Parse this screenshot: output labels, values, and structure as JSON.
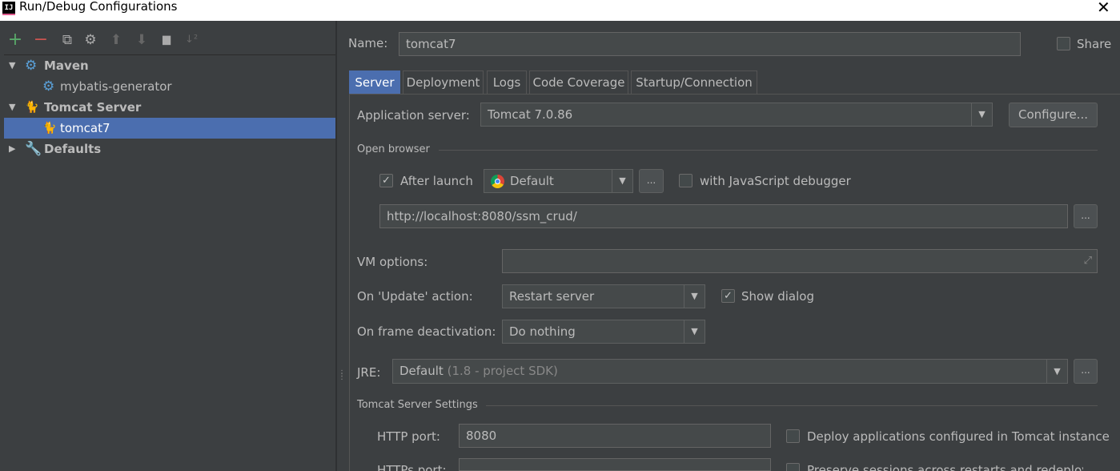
{
  "window": {
    "title": "Run/Debug Configurations",
    "app_icon": "IJ"
  },
  "toolbar": {
    "add": "+",
    "remove": "−",
    "copy": "⧉",
    "edit": "⚙",
    "up": "⬆",
    "down": "⬇",
    "folder": "▆",
    "sort": "↓²"
  },
  "tree": {
    "items": [
      {
        "label": "Maven",
        "icon": "maven-gear-icon",
        "expanded": true
      },
      {
        "label": "mybatis-generator",
        "icon": "maven-gear-icon"
      },
      {
        "label": "Tomcat Server",
        "icon": "tomcat-icon",
        "expanded": true
      },
      {
        "label": "tomcat7",
        "icon": "tomcat-icon",
        "selected": true
      },
      {
        "label": "Defaults",
        "icon": "wrench-icon",
        "expanded": false
      }
    ]
  },
  "form": {
    "name_label": "Name:",
    "name_value": "tomcat7",
    "share_label": "Share",
    "tabs": [
      "Server",
      "Deployment",
      "Logs",
      "Code Coverage",
      "Startup/Connection"
    ],
    "app_server_label": "Application server:",
    "app_server_value": "Tomcat 7.0.86",
    "configure_label": "Configure...",
    "open_browser_label": "Open browser",
    "after_launch_label": "After launch",
    "browser_value": "Default",
    "ellipsis": "...",
    "js_debugger_label": "with JavaScript debugger",
    "url_value": "http://localhost:8080/ssm_crud/",
    "vm_options_label": "VM options:",
    "on_update_label": "On 'Update' action:",
    "on_update_value": "Restart server",
    "show_dialog_label": "Show dialog",
    "on_frame_label": "On frame deactivation:",
    "on_frame_value": "Do nothing",
    "jre_label": "JRE:",
    "jre_value": "Default",
    "jre_hint": "(1.8 - project SDK)",
    "tomcat_settings_label": "Tomcat Server Settings",
    "http_port_label": "HTTP port:",
    "http_port_value": "8080",
    "deploy_label": "Deploy applications configured in Tomcat instance",
    "https_port_label": "HTTPs port:",
    "preserve_label": "Preserve sessions across restarts and redeploys"
  },
  "colors": {
    "background": "#3c3f41",
    "selection": "#4b6eaf",
    "add": "#59a869",
    "remove": "#c75450"
  }
}
